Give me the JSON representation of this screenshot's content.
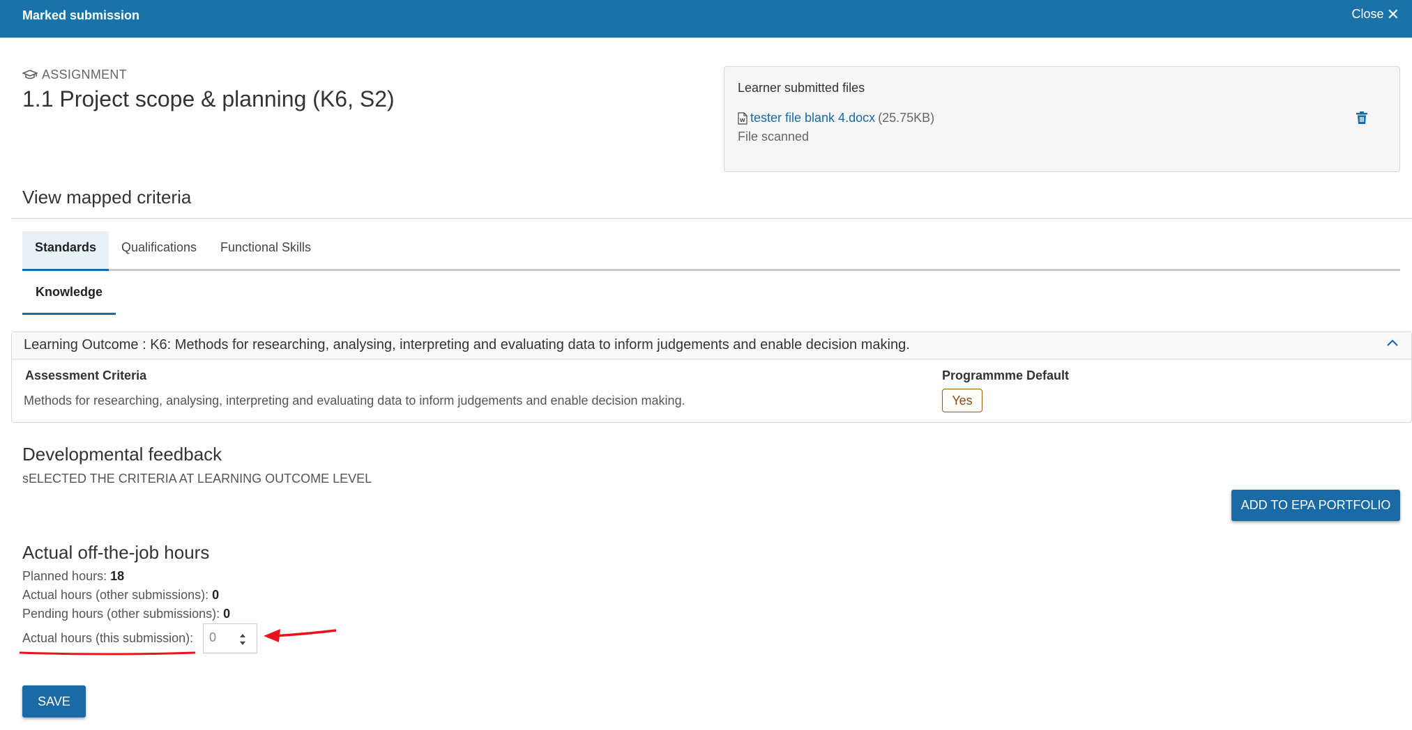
{
  "header": {
    "title": "Marked submission",
    "close_label": "Close"
  },
  "assignment": {
    "label": "ASSIGNMENT",
    "title": "1.1 Project scope & planning (K6, S2)"
  },
  "files": {
    "heading": "Learner submitted files",
    "file_name": "tester file blank 4.docx",
    "file_size": "(25.75KB)",
    "status": "File scanned"
  },
  "criteria": {
    "heading": "View mapped criteria",
    "tabs": [
      {
        "label": "Standards"
      },
      {
        "label": "Qualifications"
      },
      {
        "label": "Functional Skills"
      }
    ],
    "subtab": "Knowledge",
    "learning_outcome": "Learning Outcome : K6: Methods for researching, analysing, interpreting and evaluating data to inform judgements and enable decision making.",
    "assessment_header": "Assessment Criteria",
    "default_header": "Programmme Default",
    "assessment_value": "Methods for researching, analysing, interpreting and evaluating data to inform judgements and enable decision making.",
    "default_value": "Yes"
  },
  "feedback": {
    "heading": "Developmental feedback",
    "text": "sELECTED THE CRITERIA AT LEARNING OUTCOME LEVEL",
    "epa_button": "ADD TO EPA PORTFOLIO"
  },
  "hours": {
    "heading": "Actual off-the-job hours",
    "planned_label": "Planned hours:",
    "planned_value": "18",
    "actual_other_label": "Actual hours (other submissions):",
    "actual_other_value": "0",
    "pending_label": "Pending hours (other submissions):",
    "pending_value": "0",
    "this_label": "Actual hours (this submission):",
    "this_value": "0"
  },
  "save_label": "SAVE",
  "colors": {
    "primary": "#1a6aa6",
    "header": "#1a73a8",
    "annotation": "#e8141c"
  }
}
